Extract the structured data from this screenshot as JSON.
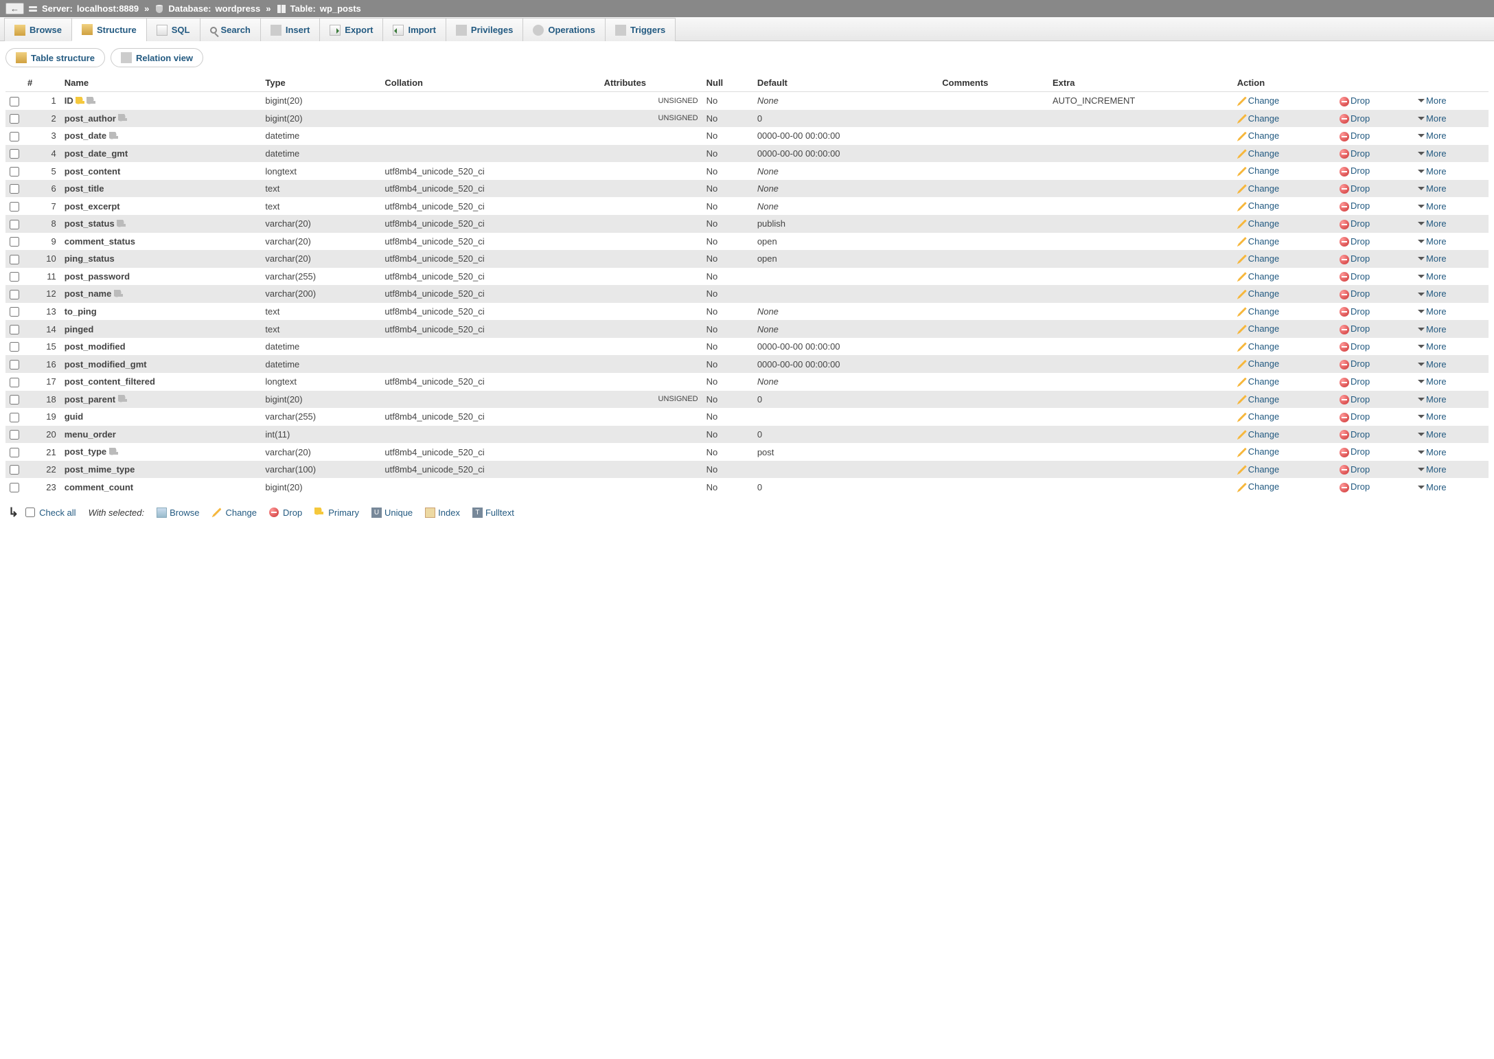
{
  "breadcrumb": {
    "server_label": "Server:",
    "server_value": "localhost:8889",
    "db_label": "Database:",
    "db_value": "wordpress",
    "table_label": "Table:",
    "table_value": "wp_posts",
    "sep": "»"
  },
  "tabs": [
    {
      "id": "browse",
      "label": "Browse"
    },
    {
      "id": "structure",
      "label": "Structure"
    },
    {
      "id": "sql",
      "label": "SQL"
    },
    {
      "id": "search",
      "label": "Search"
    },
    {
      "id": "insert",
      "label": "Insert"
    },
    {
      "id": "export",
      "label": "Export"
    },
    {
      "id": "import",
      "label": "Import"
    },
    {
      "id": "privileges",
      "label": "Privileges"
    },
    {
      "id": "operations",
      "label": "Operations"
    },
    {
      "id": "triggers",
      "label": "Triggers"
    }
  ],
  "subtabs": {
    "table_structure": "Table structure",
    "relation_view": "Relation view"
  },
  "columnsHeader": {
    "num": "#",
    "name": "Name",
    "type": "Type",
    "collation": "Collation",
    "attributes": "Attributes",
    "null": "Null",
    "default": "Default",
    "comments": "Comments",
    "extra": "Extra",
    "action": "Action"
  },
  "actions": {
    "change": "Change",
    "drop": "Drop",
    "more": "More"
  },
  "columns": [
    {
      "n": 1,
      "name": "ID",
      "key": "primary",
      "idx": true,
      "type": "bigint(20)",
      "collation": "",
      "attr": "UNSIGNED",
      "null": "No",
      "def": "None",
      "def_italic": true,
      "comments": "",
      "extra": "AUTO_INCREMENT"
    },
    {
      "n": 2,
      "name": "post_author",
      "key": "",
      "idx": true,
      "type": "bigint(20)",
      "collation": "",
      "attr": "UNSIGNED",
      "null": "No",
      "def": "0",
      "def_italic": false,
      "comments": "",
      "extra": ""
    },
    {
      "n": 3,
      "name": "post_date",
      "key": "",
      "idx": true,
      "type": "datetime",
      "collation": "",
      "attr": "",
      "null": "No",
      "def": "0000-00-00 00:00:00",
      "def_italic": false,
      "comments": "",
      "extra": ""
    },
    {
      "n": 4,
      "name": "post_date_gmt",
      "key": "",
      "idx": false,
      "type": "datetime",
      "collation": "",
      "attr": "",
      "null": "No",
      "def": "0000-00-00 00:00:00",
      "def_italic": false,
      "comments": "",
      "extra": ""
    },
    {
      "n": 5,
      "name": "post_content",
      "key": "",
      "idx": false,
      "type": "longtext",
      "collation": "utf8mb4_unicode_520_ci",
      "attr": "",
      "null": "No",
      "def": "None",
      "def_italic": true,
      "comments": "",
      "extra": ""
    },
    {
      "n": 6,
      "name": "post_title",
      "key": "",
      "idx": false,
      "type": "text",
      "collation": "utf8mb4_unicode_520_ci",
      "attr": "",
      "null": "No",
      "def": "None",
      "def_italic": true,
      "comments": "",
      "extra": ""
    },
    {
      "n": 7,
      "name": "post_excerpt",
      "key": "",
      "idx": false,
      "type": "text",
      "collation": "utf8mb4_unicode_520_ci",
      "attr": "",
      "null": "No",
      "def": "None",
      "def_italic": true,
      "comments": "",
      "extra": ""
    },
    {
      "n": 8,
      "name": "post_status",
      "key": "",
      "idx": true,
      "type": "varchar(20)",
      "collation": "utf8mb4_unicode_520_ci",
      "attr": "",
      "null": "No",
      "def": "publish",
      "def_italic": false,
      "comments": "",
      "extra": ""
    },
    {
      "n": 9,
      "name": "comment_status",
      "key": "",
      "idx": false,
      "type": "varchar(20)",
      "collation": "utf8mb4_unicode_520_ci",
      "attr": "",
      "null": "No",
      "def": "open",
      "def_italic": false,
      "comments": "",
      "extra": ""
    },
    {
      "n": 10,
      "name": "ping_status",
      "key": "",
      "idx": false,
      "type": "varchar(20)",
      "collation": "utf8mb4_unicode_520_ci",
      "attr": "",
      "null": "No",
      "def": "open",
      "def_italic": false,
      "comments": "",
      "extra": ""
    },
    {
      "n": 11,
      "name": "post_password",
      "key": "",
      "idx": false,
      "type": "varchar(255)",
      "collation": "utf8mb4_unicode_520_ci",
      "attr": "",
      "null": "No",
      "def": "",
      "def_italic": false,
      "comments": "",
      "extra": ""
    },
    {
      "n": 12,
      "name": "post_name",
      "key": "",
      "idx": true,
      "type": "varchar(200)",
      "collation": "utf8mb4_unicode_520_ci",
      "attr": "",
      "null": "No",
      "def": "",
      "def_italic": false,
      "comments": "",
      "extra": ""
    },
    {
      "n": 13,
      "name": "to_ping",
      "key": "",
      "idx": false,
      "type": "text",
      "collation": "utf8mb4_unicode_520_ci",
      "attr": "",
      "null": "No",
      "def": "None",
      "def_italic": true,
      "comments": "",
      "extra": ""
    },
    {
      "n": 14,
      "name": "pinged",
      "key": "",
      "idx": false,
      "type": "text",
      "collation": "utf8mb4_unicode_520_ci",
      "attr": "",
      "null": "No",
      "def": "None",
      "def_italic": true,
      "comments": "",
      "extra": ""
    },
    {
      "n": 15,
      "name": "post_modified",
      "key": "",
      "idx": false,
      "type": "datetime",
      "collation": "",
      "attr": "",
      "null": "No",
      "def": "0000-00-00 00:00:00",
      "def_italic": false,
      "comments": "",
      "extra": ""
    },
    {
      "n": 16,
      "name": "post_modified_gmt",
      "key": "",
      "idx": false,
      "type": "datetime",
      "collation": "",
      "attr": "",
      "null": "No",
      "def": "0000-00-00 00:00:00",
      "def_italic": false,
      "comments": "",
      "extra": ""
    },
    {
      "n": 17,
      "name": "post_content_filtered",
      "key": "",
      "idx": false,
      "type": "longtext",
      "collation": "utf8mb4_unicode_520_ci",
      "attr": "",
      "null": "No",
      "def": "None",
      "def_italic": true,
      "comments": "",
      "extra": ""
    },
    {
      "n": 18,
      "name": "post_parent",
      "key": "",
      "idx": true,
      "type": "bigint(20)",
      "collation": "",
      "attr": "UNSIGNED",
      "null": "No",
      "def": "0",
      "def_italic": false,
      "comments": "",
      "extra": ""
    },
    {
      "n": 19,
      "name": "guid",
      "key": "",
      "idx": false,
      "type": "varchar(255)",
      "collation": "utf8mb4_unicode_520_ci",
      "attr": "",
      "null": "No",
      "def": "",
      "def_italic": false,
      "comments": "",
      "extra": ""
    },
    {
      "n": 20,
      "name": "menu_order",
      "key": "",
      "idx": false,
      "type": "int(11)",
      "collation": "",
      "attr": "",
      "null": "No",
      "def": "0",
      "def_italic": false,
      "comments": "",
      "extra": ""
    },
    {
      "n": 21,
      "name": "post_type",
      "key": "",
      "idx": true,
      "type": "varchar(20)",
      "collation": "utf8mb4_unicode_520_ci",
      "attr": "",
      "null": "No",
      "def": "post",
      "def_italic": false,
      "comments": "",
      "extra": ""
    },
    {
      "n": 22,
      "name": "post_mime_type",
      "key": "",
      "idx": false,
      "type": "varchar(100)",
      "collation": "utf8mb4_unicode_520_ci",
      "attr": "",
      "null": "No",
      "def": "",
      "def_italic": false,
      "comments": "",
      "extra": ""
    },
    {
      "n": 23,
      "name": "comment_count",
      "key": "",
      "idx": false,
      "type": "bigint(20)",
      "collation": "",
      "attr": "",
      "null": "No",
      "def": "0",
      "def_italic": false,
      "comments": "",
      "extra": ""
    }
  ],
  "bottom": {
    "check_all": "Check all",
    "with_selected": "With selected:",
    "browse": "Browse",
    "change": "Change",
    "drop": "Drop",
    "primary": "Primary",
    "unique": "Unique",
    "index": "Index",
    "fulltext": "Fulltext"
  }
}
